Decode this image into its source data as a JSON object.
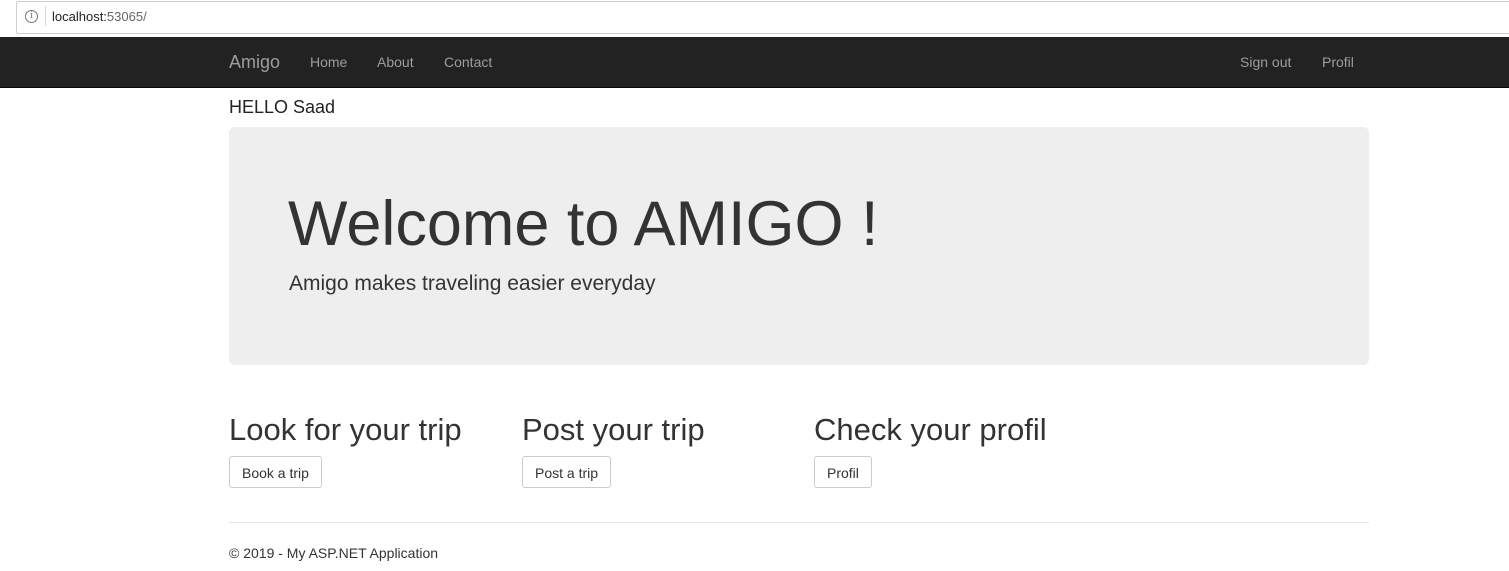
{
  "browser": {
    "url_host": "localhost:",
    "url_port": "53065/",
    "info_icon": "info-icon"
  },
  "navbar": {
    "brand": "Amigo",
    "left_links": [
      "Home",
      "About",
      "Contact"
    ],
    "right_links": [
      "Sign out",
      "Profil"
    ]
  },
  "greeting": "HELLO Saad",
  "jumbotron": {
    "title": "Welcome to AMIGO !",
    "lead": "Amigo makes traveling easier everyday"
  },
  "columns": [
    {
      "heading": "Look for your trip",
      "button": "Book a trip"
    },
    {
      "heading": "Post your trip",
      "button": "Post a trip"
    },
    {
      "heading": "Check your profil",
      "button": "Profil"
    }
  ],
  "footer": {
    "text": "© 2019 - My ASP.NET Application"
  },
  "colors": {
    "navbar_bg": "#222222",
    "nav_text": "#9d9d9d",
    "jumbotron_bg": "#eeeeee",
    "text": "#333333"
  }
}
